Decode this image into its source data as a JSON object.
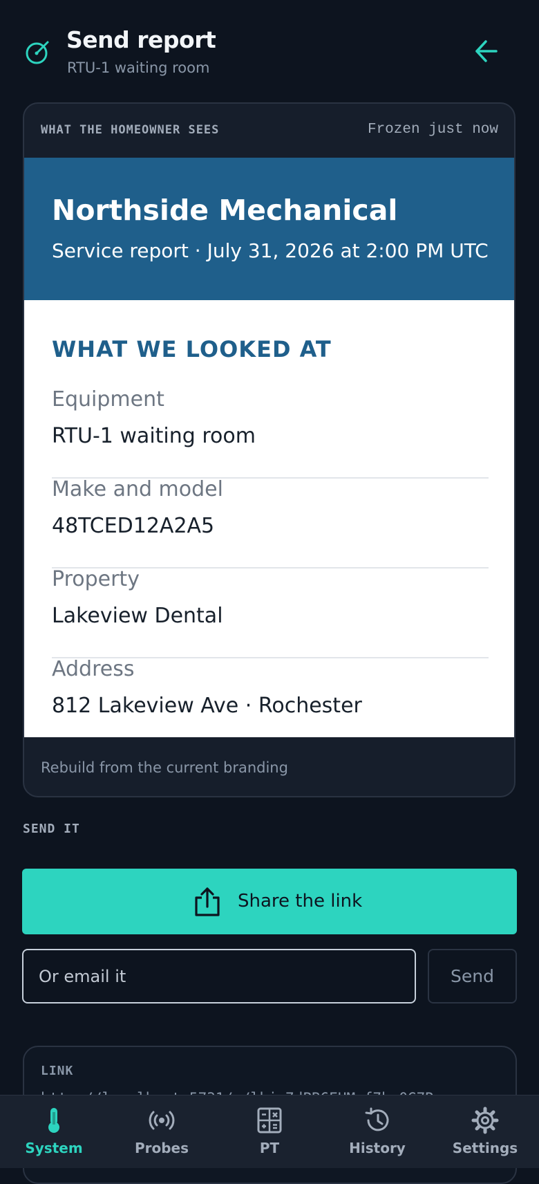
{
  "header": {
    "title": "Send report",
    "subtitle": "RTU-1 waiting room"
  },
  "preview": {
    "label": "WHAT THE HOMEOWNER SEES",
    "frozen": "Frozen just now",
    "company": "Northside Mechanical",
    "report_line": "Service report · July 31, 2026 at 2:00 PM UTC",
    "section_title": "WHAT WE LOOKED AT",
    "rows": [
      {
        "label": "Equipment",
        "value": "RTU-1 waiting room"
      },
      {
        "label": "Make and model",
        "value": "48TCED12A2A5"
      },
      {
        "label": "Property",
        "value": "Lakeview Dental"
      },
      {
        "label": "Address",
        "value": "812 Lakeview Ave · Rochester"
      }
    ],
    "rebuild": "Rebuild from the current branding"
  },
  "send": {
    "label": "SEND IT",
    "share_label": "Share the link",
    "email_placeholder": "Or email it",
    "send_label": "Send"
  },
  "link": {
    "label": "LINK",
    "url": "http://localhost:5731/r/lkj_7dPB6EHM_f7b_0G7R"
  },
  "nav": {
    "items": [
      {
        "label": "System",
        "icon": "thermometer-icon",
        "active": true
      },
      {
        "label": "Probes",
        "icon": "wireless-probe-icon"
      },
      {
        "label": "PT",
        "icon": "calculator-icon"
      },
      {
        "label": "History",
        "icon": "history-icon"
      },
      {
        "label": "Settings",
        "icon": "gear-icon"
      }
    ]
  },
  "colors": {
    "accent": "#2dd4bf",
    "background": "#0d141f",
    "brand_banner": "#1f5f8b"
  }
}
